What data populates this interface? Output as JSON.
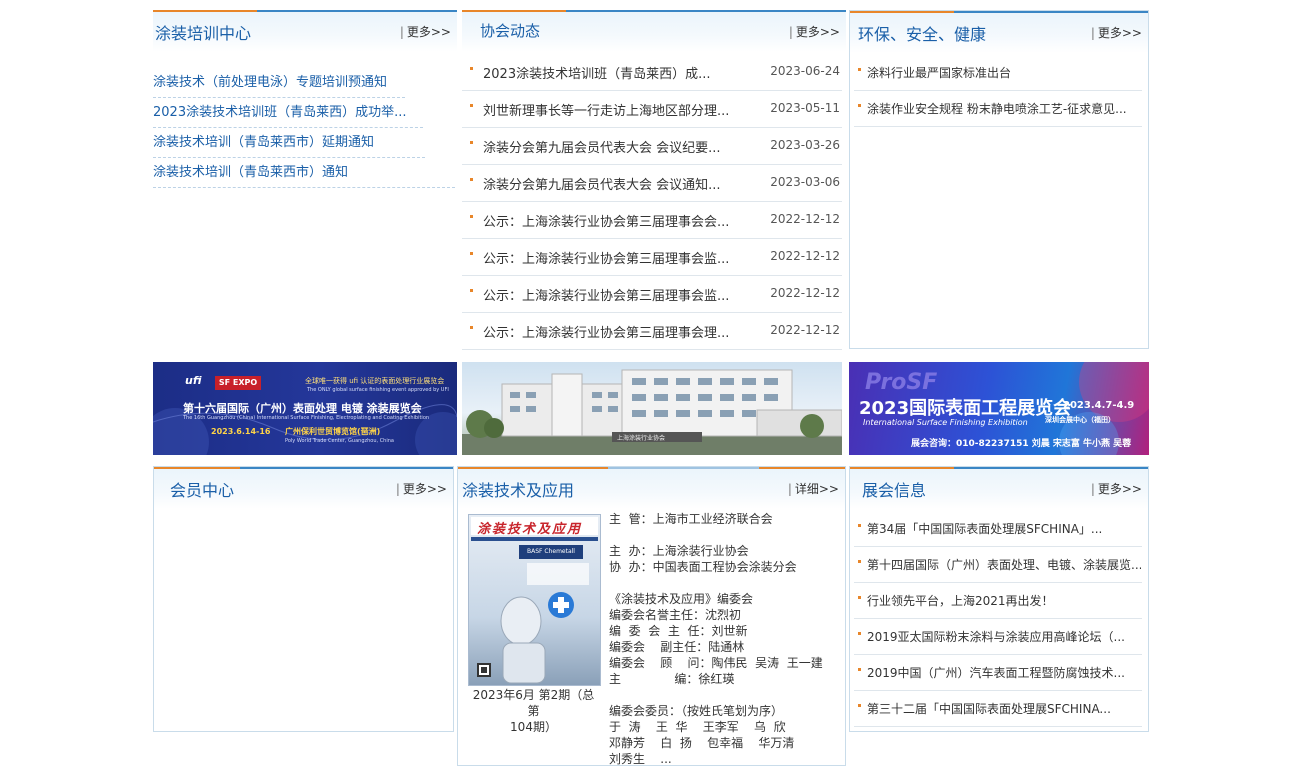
{
  "training": {
    "title": "涂装培训中心",
    "more": "更多>>",
    "items": [
      "涂装技术（前处理电泳）专题培训预通知",
      "2023涂装技术培训班（青岛莱西）成功举...",
      "涂装技术培训（青岛莱西市）延期通知",
      "涂装技术培训（青岛莱西市）通知"
    ]
  },
  "news": {
    "title": "协会动态",
    "more": "更多>>",
    "items": [
      {
        "title": "2023涂装技术培训班（青岛莱西）成...",
        "date": "2023-06-24"
      },
      {
        "title": "刘世新理事长等一行走访上海地区部分理...",
        "date": "2023-05-11"
      },
      {
        "title": "涂装分会第九届会员代表大会 会议纪要...",
        "date": "2023-03-26"
      },
      {
        "title": "涂装分会第九届会员代表大会 会议通知...",
        "date": "2023-03-06"
      },
      {
        "title": "公示：上海涂装行业协会第三届理事会会...",
        "date": "2022-12-12"
      },
      {
        "title": "公示：上海涂装行业协会第三届理事会监...",
        "date": "2022-12-12"
      },
      {
        "title": "公示：上海涂装行业协会第三届理事会监...",
        "date": "2022-12-12"
      },
      {
        "title": "公示：上海涂装行业协会第三届理事会理...",
        "date": "2022-12-12"
      }
    ]
  },
  "ehs": {
    "title": "环保、安全、健康",
    "more": "更多>>",
    "items": [
      "涂料行业最严国家标准出台",
      "涂装作业安全规程 粉末静电喷涂工艺-征求意见..."
    ]
  },
  "banners": {
    "left": {
      "tag": "全球唯一获得 ufi 认证的表面处理行业展览会",
      "tag_en": "The ONLY global surface finishing event approved by UFI",
      "title": "第十六届国际（广州）表面处理 电镀 涂装展览会",
      "subtitle": "The 16th Guangzhou (China) International Surface Finishing, Electroplating and Coating Exhibition",
      "date": "2023.6.14-16",
      "venue": "广州保利世贸博览馆(琶洲)",
      "venue_en": "Poly World Trade Center, Guangzhou, China",
      "logo_ufi": "ufi",
      "logo_sf": "SF EXPO"
    },
    "center": {
      "sign": "上海涂装行业协会"
    },
    "right": {
      "brand": "ProSF",
      "title": "2023国际表面工程展览会",
      "subtitle": "International Surface Finishing Exhibition",
      "date": "2023.4.7-4.9",
      "venue": "深圳会展中心（福田）",
      "contact": "展会咨询：010-82237151 刘晨 宋志富 牛小燕 吴蓉"
    }
  },
  "members": {
    "title": "会员中心",
    "more": "更多>>"
  },
  "journal": {
    "title": "涂装技术及应用",
    "more": "详细>>",
    "cover_title": "涂装技术及应用",
    "cover_brand": "BASF Chemetall",
    "issue_line1": "2023年6月 第2期（总第",
    "issue_line2": "104期）",
    "info": "主  管：上海市工业经济联合会\n\n主  办：上海涂装行业协会\n协  办：中国表面工程协会涂装分会\n\n《涂装技术及应用》编委会\n编委会名誉主任：沈烈初\n编  委  会  主  任：刘世新\n编委会    副主任：陆通林\n编委会    顾    问：陶伟民  吴涛  王一建\n主              编：徐红瑛\n\n编委会委员：（按姓氏笔划为序）\n于  涛    王  华    王李军    乌  欣\n邓静芳    白  扬    包幸福    华万清\n刘秀生    ..."
  },
  "expo": {
    "title": "展会信息",
    "more": "更多>>",
    "items": [
      "第34届「中国国际表面处理展SFCHINA」...",
      "第十四届国际（广州）表面处理、电镀、涂装展览...",
      "行业领先平台，上海2021再出发！",
      "2019亚太国际粉末涂料与涂装应用高峰论坛（...",
      "2019中国（广州）汽车表面工程暨防腐蚀技术...",
      "第三十二届「中国国际表面处理展SFCHINA..."
    ]
  },
  "colors": {
    "accent": "#e8862a",
    "brand_blue": "#1a5fa8",
    "rule_blue": "#3a86c5"
  }
}
